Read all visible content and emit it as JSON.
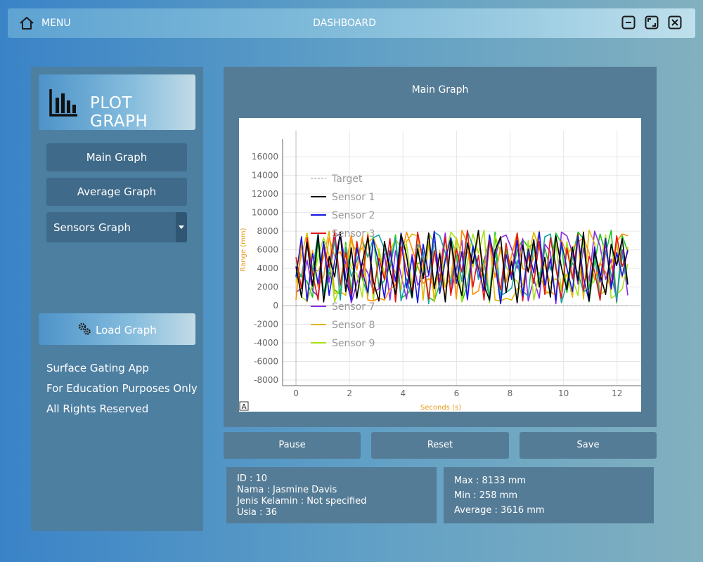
{
  "topbar": {
    "menu_label": "MENU",
    "title": "DASHBOARD",
    "icons": [
      "home-icon",
      "minimize-icon",
      "maximize-icon",
      "close-icon"
    ]
  },
  "sidebar": {
    "header_title": "PLOT GRAPH",
    "header_icon": "bar-chart-icon",
    "nav": {
      "main_graph": "Main Graph",
      "average_graph": "Average Graph",
      "sensors_graph": "Sensors Graph"
    },
    "load_button": "Load Graph",
    "load_icon": "gears-icon",
    "info": [
      "Surface Gating App",
      "For Education Purposes Only",
      "All Rights Reserved"
    ]
  },
  "graph": {
    "title": "Main Graph",
    "auto_button_label": "A"
  },
  "chart_data": {
    "type": "line",
    "title": "",
    "xlabel": "Seconds (s)",
    "ylabel": "Range (mm)",
    "xlim": [
      -0.5,
      12.9
    ],
    "ylim": [
      -8600,
      18800
    ],
    "xticks": [
      0,
      2,
      4,
      6,
      8,
      10,
      12
    ],
    "yticks": [
      16000,
      14000,
      12000,
      10000,
      8000,
      6000,
      4000,
      2000,
      0,
      -2000,
      -4000,
      -6000,
      -8000
    ],
    "grid": true,
    "legend_position": "top-left",
    "target": {
      "name": "Target",
      "value": 0,
      "color": "#aaaaaa",
      "style": "dashed"
    },
    "series": [
      {
        "name": "Sensor 1",
        "color": "#000000",
        "values": [
          4200,
          900,
          6800,
          2100,
          7600,
          400,
          5300,
          3100,
          7900,
          1500,
          6200,
          800,
          4700,
          7300,
          2600,
          500,
          6900,
          3800,
          1200,
          7700,
          5400,
          900,
          6100,
          2900,
          7800,
          1800,
          5600,
          400,
          7000,
          3300,
          1100,
          6700,
          4500,
          8100,
          2200,
          600,
          5900,
          7400,
          1400,
          4800,
          300,
          6500,
          3600,
          7100,
          2000,
          5200,
          900,
          7500,
          4100,
          1700,
          6300,
          2700,
          7900,
          500,
          5800,
          3400,
          1200,
          6600,
          4300,
          7200,
          2300
        ]
      },
      {
        "name": "Sensor 2",
        "color": "#1515e0",
        "values": [
          3100,
          7400,
          500,
          5600,
          2300,
          6900,
          1100,
          4800,
          7700,
          2900,
          600,
          6200,
          3700,
          1400,
          7100,
          4400,
          800,
          5900,
          2600,
          7800,
          1900,
          5200,
          300,
          6600,
          3300,
          8000,
          1300,
          4900,
          7300,
          2400,
          5800,
          700,
          6400,
          3900,
          1600,
          7600,
          4600,
          200,
          5500,
          2800,
          7000,
          1000,
          6100,
          3500,
          7900,
          2200,
          5000,
          600,
          6800,
          4000,
          1500,
          7500,
          3000,
          500,
          6300,
          2500,
          7200,
          1800,
          5700,
          3200,
          6000
        ]
      },
      {
        "name": "Sensor 3",
        "color": "#e01515",
        "values": [
          5200,
          1800,
          7300,
          3400,
          600,
          6600,
          4100,
          8000,
          2200,
          5700,
          900,
          6900,
          3000,
          7600,
          1300,
          5100,
          2800,
          7200,
          400,
          6300,
          3800,
          1500,
          7900,
          4600,
          700,
          5900,
          2500,
          7400,
          1100,
          6100,
          3600,
          8100,
          2000,
          5400,
          600,
          7000,
          4300,
          1700,
          6700,
          3100,
          7800,
          500,
          5600,
          2400,
          6900,
          1200,
          7300,
          4000,
          800,
          6200,
          2900,
          7700,
          1600,
          5300,
          3700,
          600,
          6800,
          2100,
          7500,
          4200,
          5800
        ]
      }
    ],
    "legend_entries": [
      "Target",
      "Sensor 1",
      "Sensor 2",
      "Sensor 3",
      "Sensor 7",
      "Sensor 8",
      "Sensor 9"
    ],
    "extra_colors": [
      "#16c816",
      "#8a2be2",
      "#e0b800",
      "#a8e01a",
      "#1aa3a3",
      "#ff8c00"
    ]
  },
  "actions": {
    "pause": "Pause",
    "reset": "Reset",
    "save": "Save"
  },
  "person": {
    "id": "ID : 10",
    "name": "Nama : Jasmine Davis",
    "gender": "Jenis Kelamin : Not specified",
    "age": "Usia : 36"
  },
  "stats": {
    "max": "Max : 8133 mm",
    "min": "Min : 258 mm",
    "average": "Average : 3616 mm"
  }
}
